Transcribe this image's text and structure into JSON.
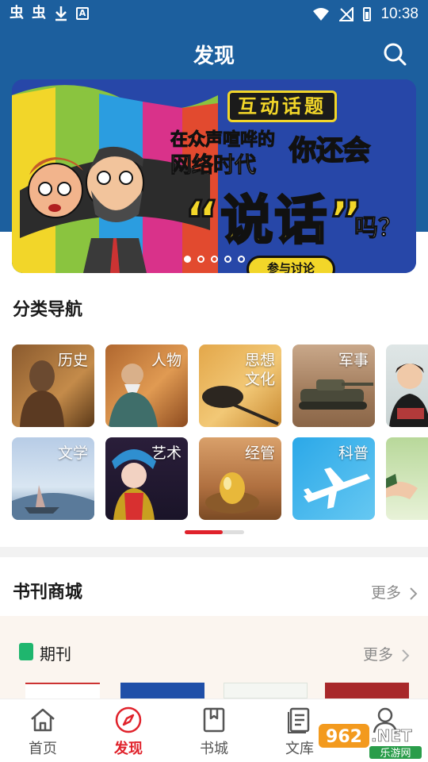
{
  "status_bar": {
    "time": "10:38",
    "left_glyphs": [
      "虫",
      "虫"
    ]
  },
  "header": {
    "title": "发现"
  },
  "banner": {
    "tag": "互动话题",
    "line1": "在众声喧哗的",
    "line2": "网络时代",
    "line3": "你还会",
    "line4": "“说话”",
    "line5": "吗？",
    "cta": "参与讨论",
    "page_count": 5,
    "active_page": 1
  },
  "category_nav": {
    "title": "分类导航",
    "items": [
      {
        "label": "历史"
      },
      {
        "label": "人物"
      },
      {
        "label": "思想文化"
      },
      {
        "label": "军事"
      },
      {
        "label": ""
      },
      {
        "label": "文学"
      },
      {
        "label": "艺术"
      },
      {
        "label": "经管"
      },
      {
        "label": "科普"
      },
      {
        "label": ""
      }
    ]
  },
  "bookstore": {
    "title": "书刊商城",
    "more": "更多",
    "periodical": {
      "title": "期刊",
      "more": "更多"
    }
  },
  "bottom_nav": {
    "items": [
      {
        "label": "首页",
        "icon": "home-icon"
      },
      {
        "label": "发现",
        "icon": "compass-icon",
        "active": true
      },
      {
        "label": "书城",
        "icon": "book-icon"
      },
      {
        "label": "文库",
        "icon": "library-icon"
      },
      {
        "label": "",
        "icon": "user-icon"
      }
    ]
  },
  "watermark": {
    "line1": "962.NET",
    "line2": "乐游网"
  },
  "colors": {
    "header_blue": "#1c5f9e",
    "accent_red": "#e0222b",
    "banner_yellow": "#f2d629",
    "periodical_green": "#1fb66e"
  }
}
